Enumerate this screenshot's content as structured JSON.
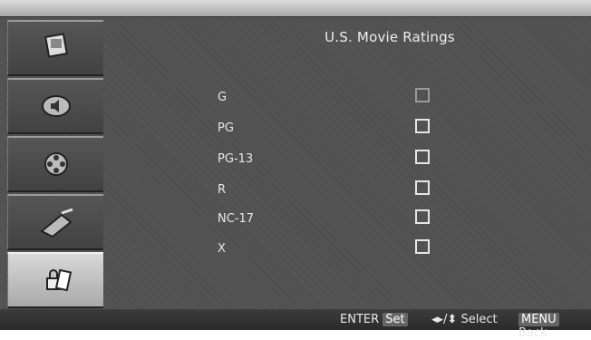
{
  "screen": {
    "title": "U.S. Movie Ratings"
  },
  "sidebar": {
    "tabs": [
      {
        "icon": "picture-icon",
        "active": false
      },
      {
        "icon": "audio-icon",
        "active": false
      },
      {
        "icon": "film-reel-icon",
        "active": false
      },
      {
        "icon": "setup-icon",
        "active": false
      },
      {
        "icon": "lock-icon",
        "active": true
      }
    ]
  },
  "ratings": [
    {
      "label": "G",
      "checked": false
    },
    {
      "label": "PG",
      "checked": false
    },
    {
      "label": "PG-13",
      "checked": false
    },
    {
      "label": "R",
      "checked": false
    },
    {
      "label": "NC-17",
      "checked": false
    },
    {
      "label": "X",
      "checked": false
    }
  ],
  "footer": {
    "enter_key": "ENTER",
    "enter_action": "Set",
    "arrows": "◂▸/⬍",
    "select_action": "Select",
    "menu_key": "MENU",
    "menu_action": "Back"
  }
}
